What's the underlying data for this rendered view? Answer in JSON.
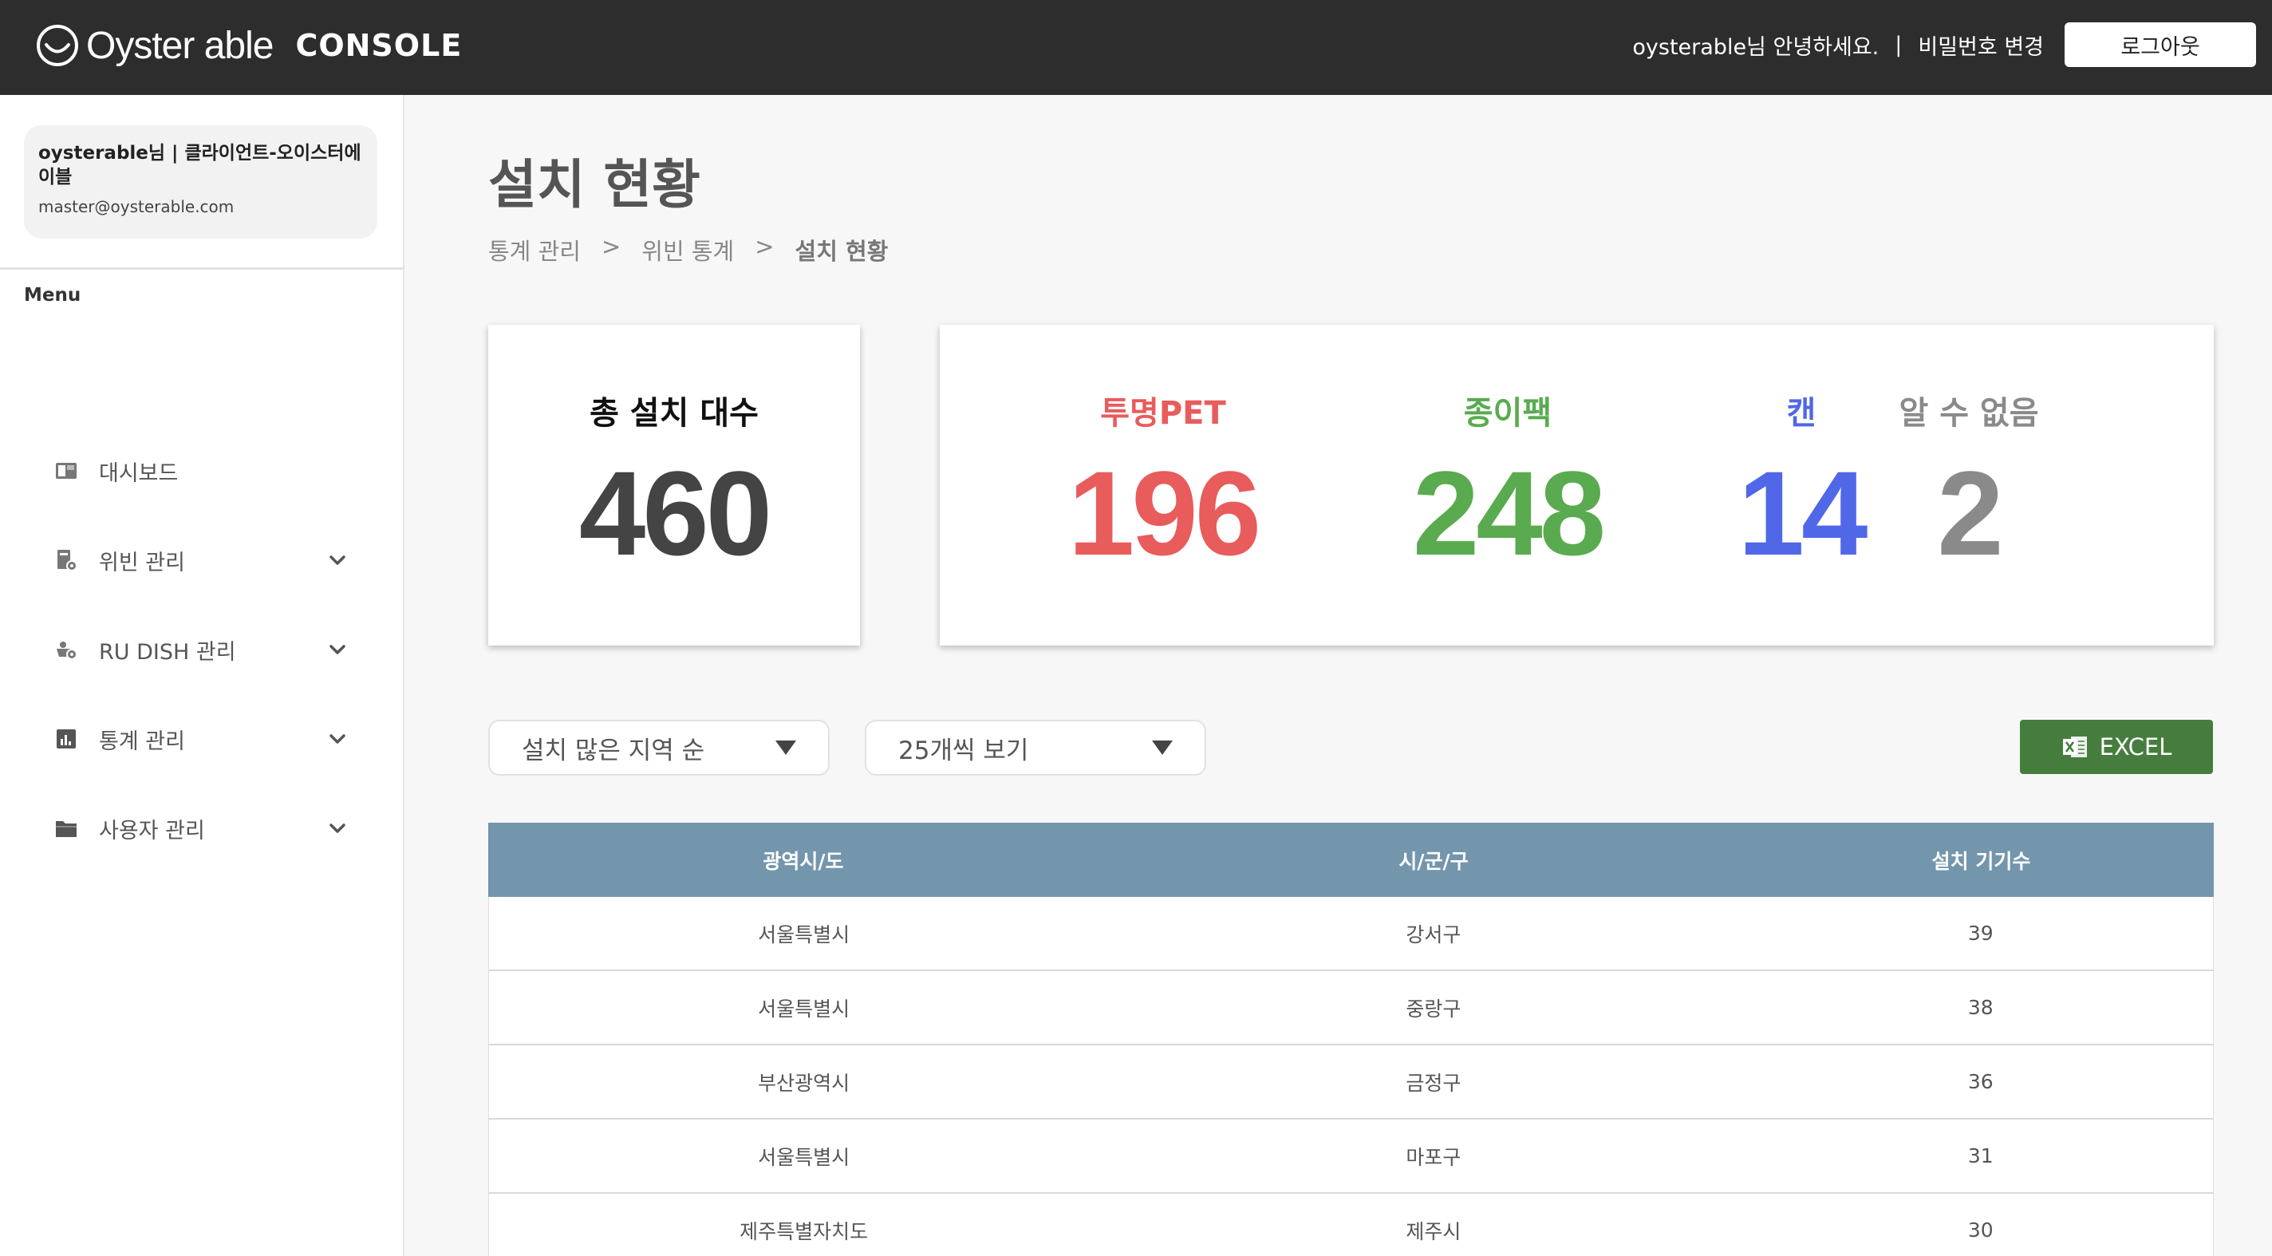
{
  "header": {
    "brand": "Oyster able",
    "console": "CONSOLE",
    "greeting": "oysterable님 안녕하세요.",
    "separator": "|",
    "change_password": "비밀번호 변경",
    "logout": "로그아웃"
  },
  "sidebar": {
    "profile": {
      "name": "oysterable님 | 클라이언트-오이스터에이블",
      "email": "master@oysterable.com"
    },
    "menu_label": "Menu",
    "items": [
      {
        "label": "대시보드",
        "icon": "dashboard-icon"
      },
      {
        "label": "위빈 관리",
        "icon": "bin-settings-icon"
      },
      {
        "label": "RU DISH 관리",
        "icon": "dish-settings-icon"
      },
      {
        "label": "통계 관리",
        "icon": "bar-chart-icon"
      },
      {
        "label": "사용자 관리",
        "icon": "folder-user-icon"
      }
    ]
  },
  "page": {
    "title": "설치 현황",
    "breadcrumb": [
      "통계 관리",
      ">",
      "위빈 통계",
      ">",
      "설치 현황"
    ]
  },
  "summary": {
    "total_label": "총 설치 대수",
    "total_value": "460",
    "types": [
      {
        "label": "투명PET",
        "value": "196",
        "color": "#e85c5c"
      },
      {
        "label": "종이팩",
        "value": "248",
        "color": "#5aab4f"
      },
      {
        "label": "캔",
        "value": "14",
        "color": "#5067e8"
      },
      {
        "label": "알 수 없음",
        "value": "2",
        "color": "#8a8a8a"
      }
    ]
  },
  "filters": {
    "sort_selected": "설치 많은 지역 순",
    "page_size_selected": "25개씩 보기",
    "excel_label": "EXCEL"
  },
  "table": {
    "headers": [
      "광역시/도",
      "시/군/구",
      "설치 기기수"
    ],
    "rows": [
      [
        "서울특별시",
        "강서구",
        "39"
      ],
      [
        "서울특별시",
        "중랑구",
        "38"
      ],
      [
        "부산광역시",
        "금정구",
        "36"
      ],
      [
        "서울특별시",
        "마포구",
        "31"
      ],
      [
        "제주특별자치도",
        "제주시",
        "30"
      ]
    ]
  },
  "colors": {
    "topbar": "#2d2d2d",
    "table_header": "#7396ad",
    "excel": "#467d3f"
  }
}
